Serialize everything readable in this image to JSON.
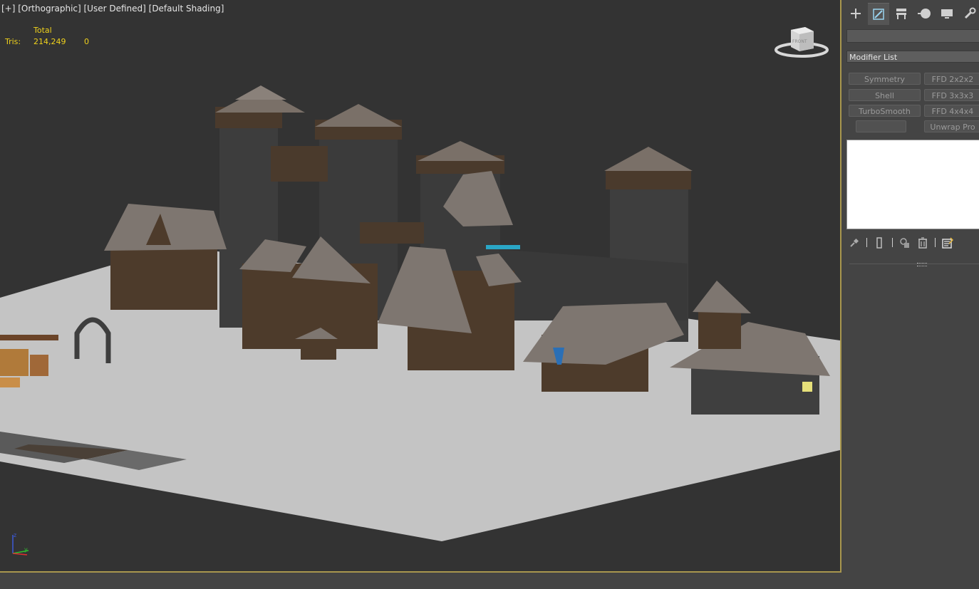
{
  "viewport": {
    "label": "[+] [Orthographic] [User Defined] [Default Shading]",
    "stats": {
      "header": "Total",
      "row_label": "Tris:",
      "total": "214,249",
      "selected": "0"
    },
    "viewcube": {
      "face_label": "FRONT"
    },
    "axis": {
      "z": "z",
      "y": "y"
    }
  },
  "panel": {
    "tabs": [
      {
        "icon": "create-plus-icon"
      },
      {
        "icon": "modify-icon",
        "active": true
      },
      {
        "icon": "hierarchy-icon"
      },
      {
        "icon": "motion-icon"
      },
      {
        "icon": "display-icon"
      },
      {
        "icon": "utilities-wrench-icon"
      }
    ],
    "name_field": "",
    "modifier_list": "Modifier List",
    "modifier_buttons": [
      {
        "label": "Symmetry"
      },
      {
        "label": "FFD 2x2x2"
      },
      {
        "label": "Shell"
      },
      {
        "label": "FFD 3x3x3"
      },
      {
        "label": "TurboSmooth"
      },
      {
        "label": "FFD 4x4x4"
      },
      {
        "label": ""
      },
      {
        "label": "Unwrap Pro"
      }
    ],
    "stack_tools": [
      "pin-stack-icon",
      "show-end-result-icon",
      "make-unique-icon",
      "remove-modifier-icon",
      "configure-modifier-sets-icon"
    ]
  },
  "colors": {
    "viewport_bg": "#333333",
    "viewport_border": "#a9974e",
    "ground": "#c4c4c4",
    "stats_text": "#f0d21c",
    "panel_bg": "#444444"
  }
}
